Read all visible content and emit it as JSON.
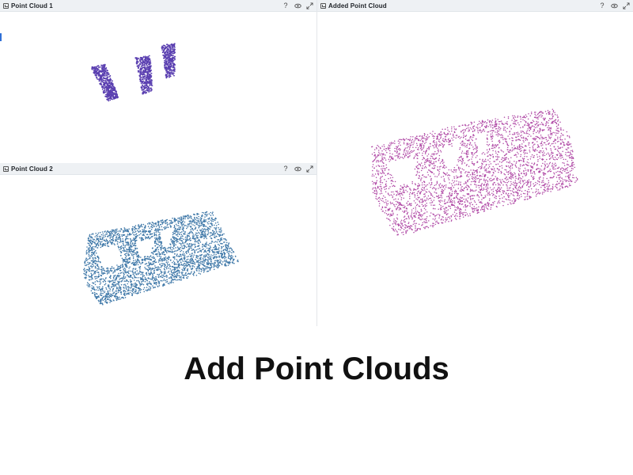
{
  "panels": {
    "pc1": {
      "title": "Point Cloud 1"
    },
    "pc2": {
      "title": "Point Cloud 2"
    },
    "added": {
      "title": "Added Point Cloud"
    }
  },
  "toolbar": {
    "help_label": "?"
  },
  "icons": {
    "view": "eye-icon",
    "expand": "expand-icon",
    "panel": "panel-icon"
  },
  "colors": {
    "pc1": "#5a3fb0",
    "pc2": "#3f78a8",
    "added": "#b04aa6"
  },
  "caption": "Add Point Clouds"
}
